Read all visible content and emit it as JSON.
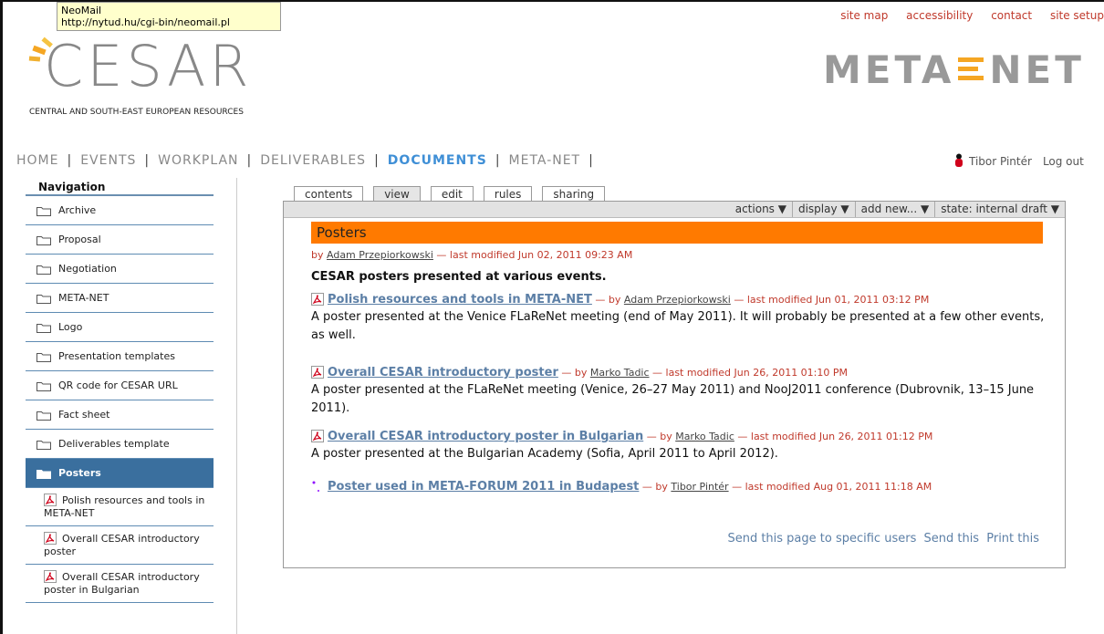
{
  "tooltip": {
    "title": "NeoMail",
    "url": "http://nytud.hu/cgi-bin/neomail.pl"
  },
  "logo": {
    "wordmark": "CESAR",
    "subtitle": "CENTRAL AND SOUTH-EAST EUROPEAN RESOURCES"
  },
  "top_links": [
    "site map",
    "accessibility",
    "contact",
    "site setup"
  ],
  "partner_logo": {
    "left": "META",
    "right": "NET"
  },
  "main_nav": [
    {
      "label": "HOME",
      "active": false
    },
    {
      "label": "EVENTS",
      "active": false
    },
    {
      "label": "WORKPLAN",
      "active": false
    },
    {
      "label": "DELIVERABLES",
      "active": false
    },
    {
      "label": "DOCUMENTS",
      "active": true
    },
    {
      "label": "META-NET",
      "active": false
    }
  ],
  "user": {
    "name": "Tibor Pintér",
    "logout": "Log out"
  },
  "sidebar": {
    "header": "Navigation",
    "folders": [
      "Archive",
      "Proposal",
      "Negotiation",
      "META-NET",
      "Logo",
      "Presentation templates",
      "QR code for CESAR URL",
      "Fact sheet",
      "Deliverables template",
      "Posters"
    ],
    "active_folder": "Posters",
    "sub_items": [
      "Polish resources and tools in META-NET",
      "Overall CESAR introductory poster",
      "Overall CESAR introductory poster in Bulgarian"
    ]
  },
  "tabs": [
    "contents",
    "view",
    "edit",
    "rules",
    "sharing"
  ],
  "active_tab": "view",
  "actions": [
    "actions ▼",
    "display ▼",
    "add new... ▼",
    "state: internal draft ▼"
  ],
  "document": {
    "title": "Posters",
    "by_prefix": "by ",
    "author": "Adam Przepiorkowski",
    "modified": " — last modified Jun 02, 2011 09:23 AM",
    "description": "CESAR posters presented at various events."
  },
  "entries": [
    {
      "title": "Polish resources and tools in META-NET",
      "by": " — by ",
      "author": "Adam Przepiorkowski",
      "modified": " — last modified Jun 01, 2011 03:12 PM",
      "text": "A poster presented at the Venice FLaReNet meeting (end of May 2011). It will probably be presented at a few other events, as well."
    },
    {
      "title": "Overall CESAR introductory poster",
      "by": " — by ",
      "author": "Marko Tadic",
      "modified": " — last modified Jun 26, 2011 01:10 PM",
      "text": "A poster presented at the FLaReNet meeting (Venice, 26–27 May 2011) and NooJ2011 conference (Dubrovnik, 13–15 June 2011)."
    },
    {
      "title": "Overall CESAR introductory poster in Bulgarian",
      "by": " — by ",
      "author": "Marko Tadic",
      "modified": " — last modified Jun 26, 2011 01:12 PM",
      "text": "A poster presented at the Bulgarian Academy (Sofia, April 2011 to April 2012)."
    },
    {
      "title": "Poster used in META-FORUM 2011 in Budapest",
      "by": " — by ",
      "author": "Tibor Pintér",
      "modified": " — last modified Aug 01, 2011 11:18 AM",
      "text": ""
    }
  ],
  "footer_links": [
    "Send this page to specific users",
    "Send this",
    "Print this"
  ]
}
